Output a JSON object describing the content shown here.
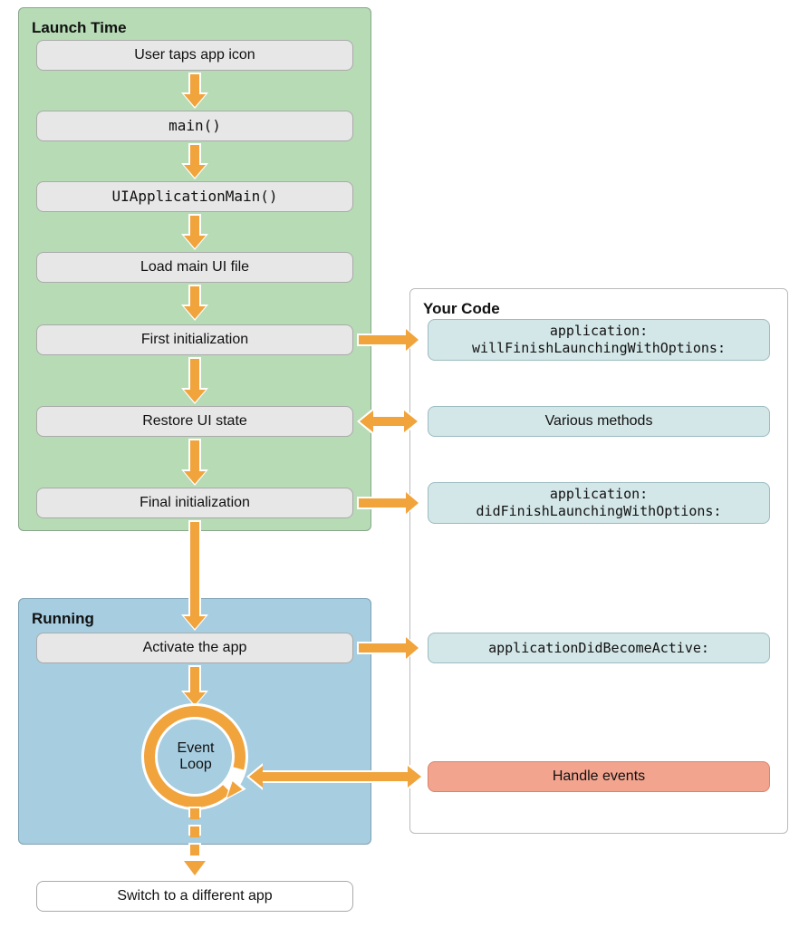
{
  "panels": {
    "launch": "Launch Time",
    "running": "Running",
    "code": "Your Code"
  },
  "launch_steps": {
    "tap": "User taps app icon",
    "main": "main()",
    "uiappmain": "UIApplicationMain()",
    "load_ui": "Load main UI file",
    "first_init": "First initialization",
    "restore": "Restore UI state",
    "final_init": "Final initialization"
  },
  "running_steps": {
    "activate": "Activate the app",
    "event_loop": "Event\nLoop"
  },
  "switch_app": "Switch to a different app",
  "code_steps": {
    "will_finish": "application:\nwillFinishLaunchingWithOptions:",
    "various": "Various methods",
    "did_finish": "application:\ndidFinishLaunchingWithOptions:",
    "become_active": "applicationDidBecomeActive:",
    "handle_events": "Handle events"
  },
  "colors": {
    "arrow": "#f1a33c",
    "arrow_outline": "#ffffff"
  }
}
